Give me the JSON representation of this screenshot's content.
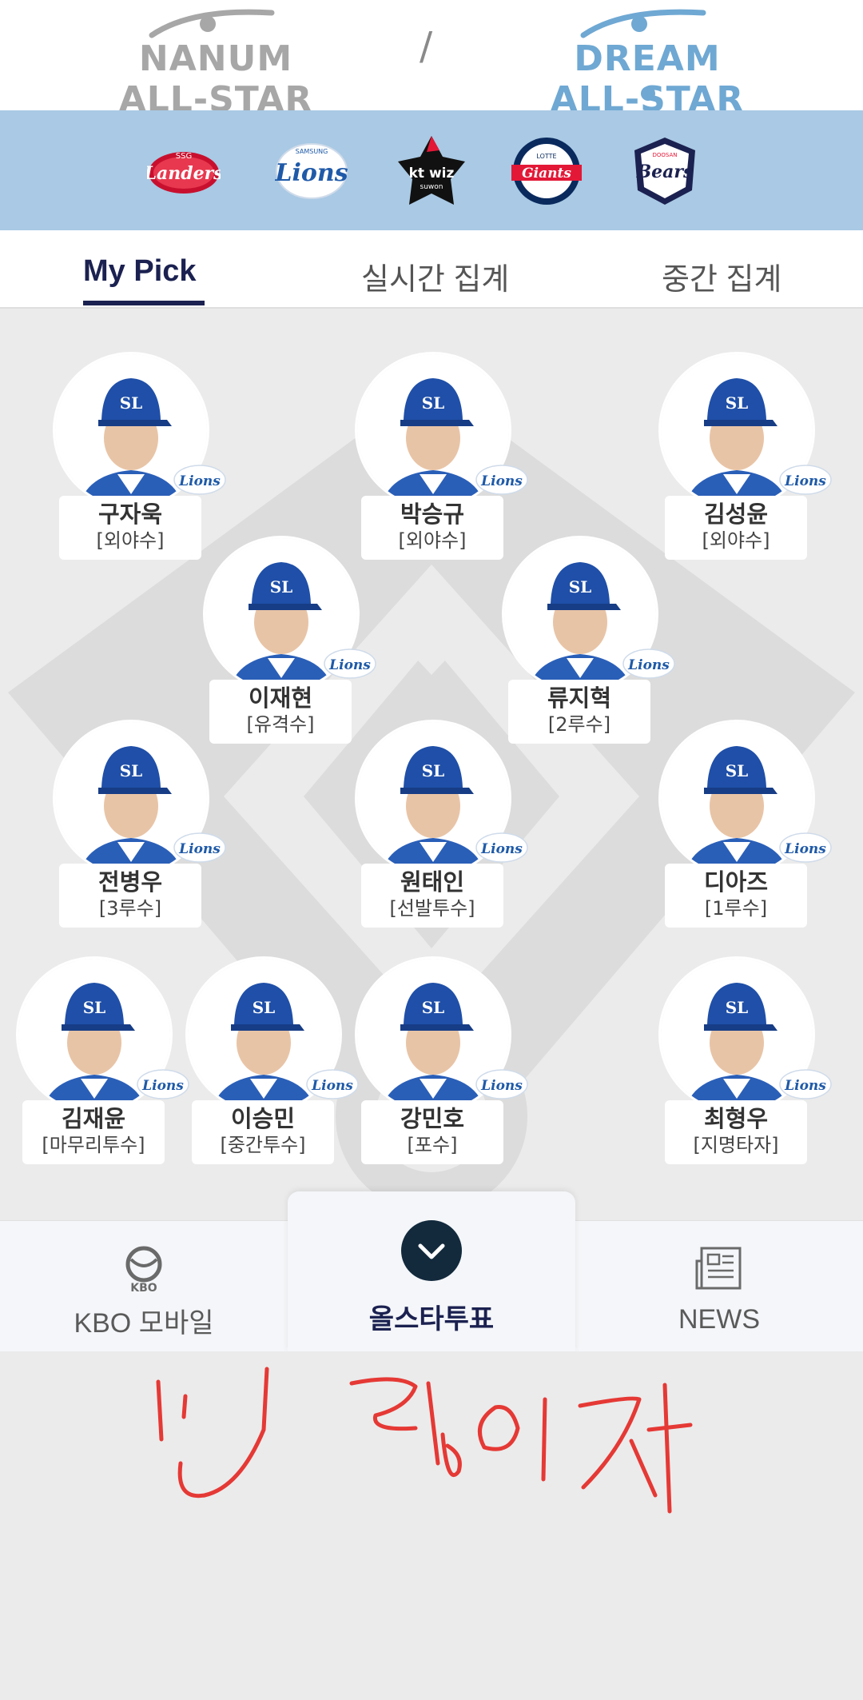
{
  "header": {
    "left_logo": "NANUM ALL-STAR",
    "separator": "/",
    "right_logo": "DREAM ALL-STAR"
  },
  "teams": [
    {
      "name": "Landers",
      "sub": "SSG",
      "color": "#c8102e"
    },
    {
      "name": "Lions",
      "sub": "SAMSUNG",
      "color": "#1f5aa8"
    },
    {
      "name": "kt wiz",
      "sub": "suwon",
      "color": "#111111"
    },
    {
      "name": "Giants",
      "sub": "LOTTE",
      "color": "#e31837"
    },
    {
      "name": "Bears",
      "sub": "DOOSAN",
      "color": "#1b2150"
    }
  ],
  "tabs": [
    {
      "label": "My Pick",
      "active": true
    },
    {
      "label": "실시간 집계",
      "active": false
    },
    {
      "label": "중간 집계",
      "active": false
    }
  ],
  "players": [
    {
      "name": "구자욱",
      "position": "[외야수]",
      "team_badge": "Lions"
    },
    {
      "name": "박승규",
      "position": "[외야수]",
      "team_badge": "Lions"
    },
    {
      "name": "김성윤",
      "position": "[외야수]",
      "team_badge": "Lions"
    },
    {
      "name": "이재현",
      "position": "[유격수]",
      "team_badge": "Lions"
    },
    {
      "name": "류지혁",
      "position": "[2루수]",
      "team_badge": "Lions"
    },
    {
      "name": "전병우",
      "position": "[3루수]",
      "team_badge": "Lions"
    },
    {
      "name": "원태인",
      "position": "[선발투수]",
      "team_badge": "Lions"
    },
    {
      "name": "디아즈",
      "position": "[1루수]",
      "team_badge": "Lions"
    },
    {
      "name": "김재윤",
      "position": "[마무리투수]",
      "team_badge": "Lions"
    },
    {
      "name": "이승민",
      "position": "[중간투수]",
      "team_badge": "Lions"
    },
    {
      "name": "강민호",
      "position": "[포수]",
      "team_badge": "Lions"
    },
    {
      "name": "최형우",
      "position": "[지명타자]",
      "team_badge": "Lions"
    }
  ],
  "bottom_nav": {
    "kbo_label": "KBO 모바일",
    "kbo_logo_text": "KBO",
    "vote_label": "올스타투표",
    "news_label": "NEWS"
  },
  "colors": {
    "team_bar": "#a9c9e4",
    "active_tab": "#1b2150",
    "vote_circle": "#132a3d",
    "cap_blue": "#1f4fa8",
    "handwriting": "#e53935"
  }
}
